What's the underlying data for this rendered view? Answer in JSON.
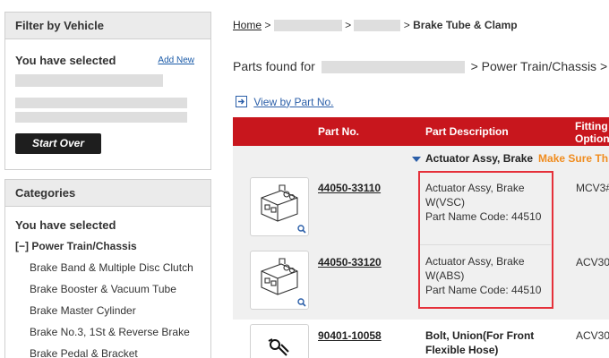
{
  "vehicle_filter": {
    "title": "Filter by Vehicle",
    "you_have_selected": "You have selected",
    "add_new": "Add New",
    "start_over": "Start Over"
  },
  "categories": {
    "title": "Categories",
    "you_have_selected": "You have selected",
    "root": "[−] Power Train/Chassis",
    "items": [
      "Brake Band & Multiple Disc Clutch",
      "Brake Booster & Vacuum Tube",
      "Brake Master Cylinder",
      "Brake No.3, 1St & Reverse Brake",
      "Brake Pedal & Bracket"
    ]
  },
  "breadcrumb": {
    "home": "Home",
    "sep": ">",
    "current": "Brake Tube & Clamp"
  },
  "parts_found": {
    "prefix": "Parts found for",
    "suffix": "> Power Train/Chassis >"
  },
  "view_by_part_no": "View by Part No.",
  "table": {
    "col_part_no": "Part No.",
    "col_description": "Part Description",
    "col_fitting_1": "Fitting",
    "col_fitting_2": "Option"
  },
  "group": {
    "title": "Actuator Assy, Brake",
    "message": "Make Sure Th"
  },
  "rows": [
    {
      "part_no": "44050-33110",
      "desc_line1": "Actuator Assy, Brake",
      "desc_line2": "W(VSC)",
      "desc_line3": "Part Name Code: 44510",
      "fitting": "MCV3#"
    },
    {
      "part_no": "44050-33120",
      "desc_line1": "Actuator Assy, Brake",
      "desc_line2": "W(ABS)",
      "desc_line3": "Part Name Code: 44510",
      "fitting": "ACV30"
    },
    {
      "part_no": "90401-10058",
      "desc_line1": "Bolt, Union(For Front",
      "desc_line2": "Flexible Hose)",
      "fitting": "ACV30"
    }
  ],
  "colors": {
    "table_header": "#c8161d",
    "link_blue": "#2a5ea8",
    "highlight_red": "#e5303a",
    "warning_orange": "#f08c1e"
  },
  "icons": [
    "zoom-icon",
    "arrow-right-box-icon",
    "triangle-down-icon",
    "part-thumbnail-image"
  ]
}
